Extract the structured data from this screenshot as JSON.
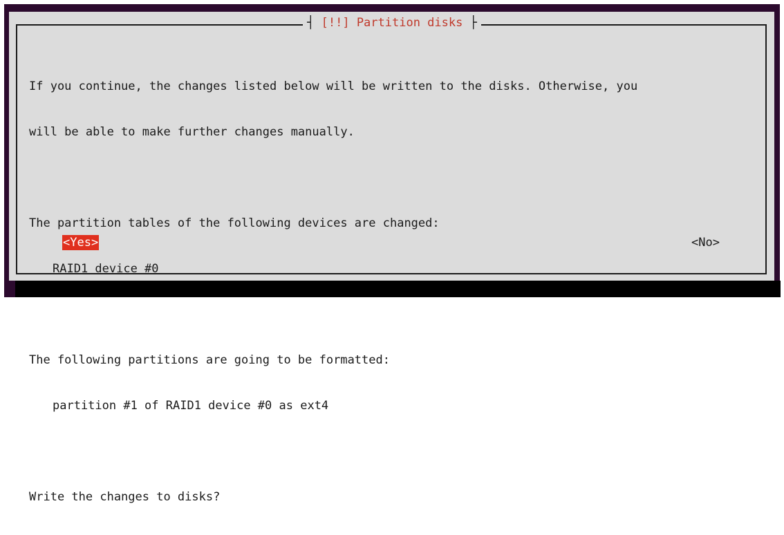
{
  "dialog": {
    "title_left_bar": "┤",
    "title": "[!!] Partition disks",
    "title_right_bar": "├",
    "lines": {
      "intro_1": "If you continue, the changes listed below will be written to the disks. Otherwise, you",
      "intro_2": "will be able to make further changes manually.",
      "tables_heading": "The partition tables of the following devices are changed:",
      "tables_item_1": "RAID1 device #0",
      "format_heading": "The following partitions are going to be formatted:",
      "format_item_1": "partition #1 of RAID1 device #0 as ext4",
      "question": "Write the changes to disks?"
    },
    "buttons": {
      "yes": "<Yes>",
      "no": "<No>"
    },
    "selected_button": "yes"
  },
  "colors": {
    "console_background": "#2c0a2e",
    "dialog_background": "#dcdcdc",
    "title_text": "#c0392b",
    "selected_button_bg": "#e0301e",
    "selected_button_text": "#ffffff",
    "text": "#1a1a1a"
  }
}
